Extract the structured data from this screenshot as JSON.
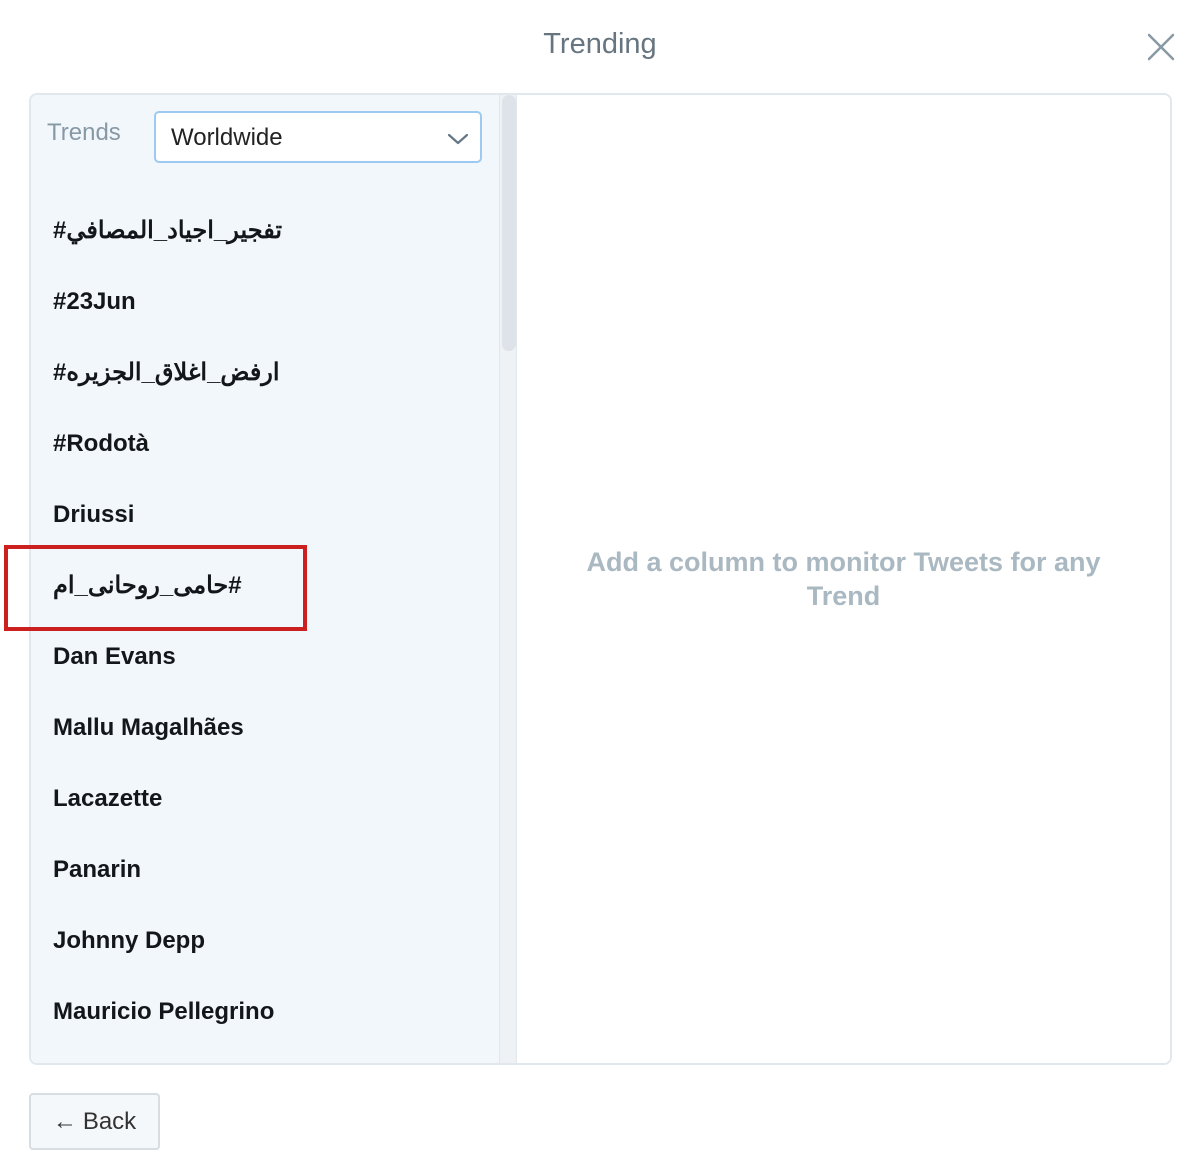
{
  "modal": {
    "title": "Trending",
    "close_icon": "close-icon"
  },
  "trends": {
    "label": "Trends",
    "location_selected": "Worldwide",
    "dropdown_icon": "chevron-down-icon",
    "items": [
      "تفجير_اجياد_المصافي#",
      "#23Jun",
      "ارفض_اغلاق_الجزيره#",
      "#Rodotà",
      "Driussi",
      "#حامی_روحانی_ام",
      "Dan Evans",
      "Mallu Magalhães",
      "Lacazette",
      "Panarin",
      "Johnny Depp",
      "Mauricio Pellegrino"
    ],
    "highlighted_index": 5,
    "highlight_color": "#cc1f1f"
  },
  "detail": {
    "empty_message": "Add a column to monitor Tweets for any Trend"
  },
  "footer": {
    "back_arrow": "←",
    "back_label": "Back"
  }
}
